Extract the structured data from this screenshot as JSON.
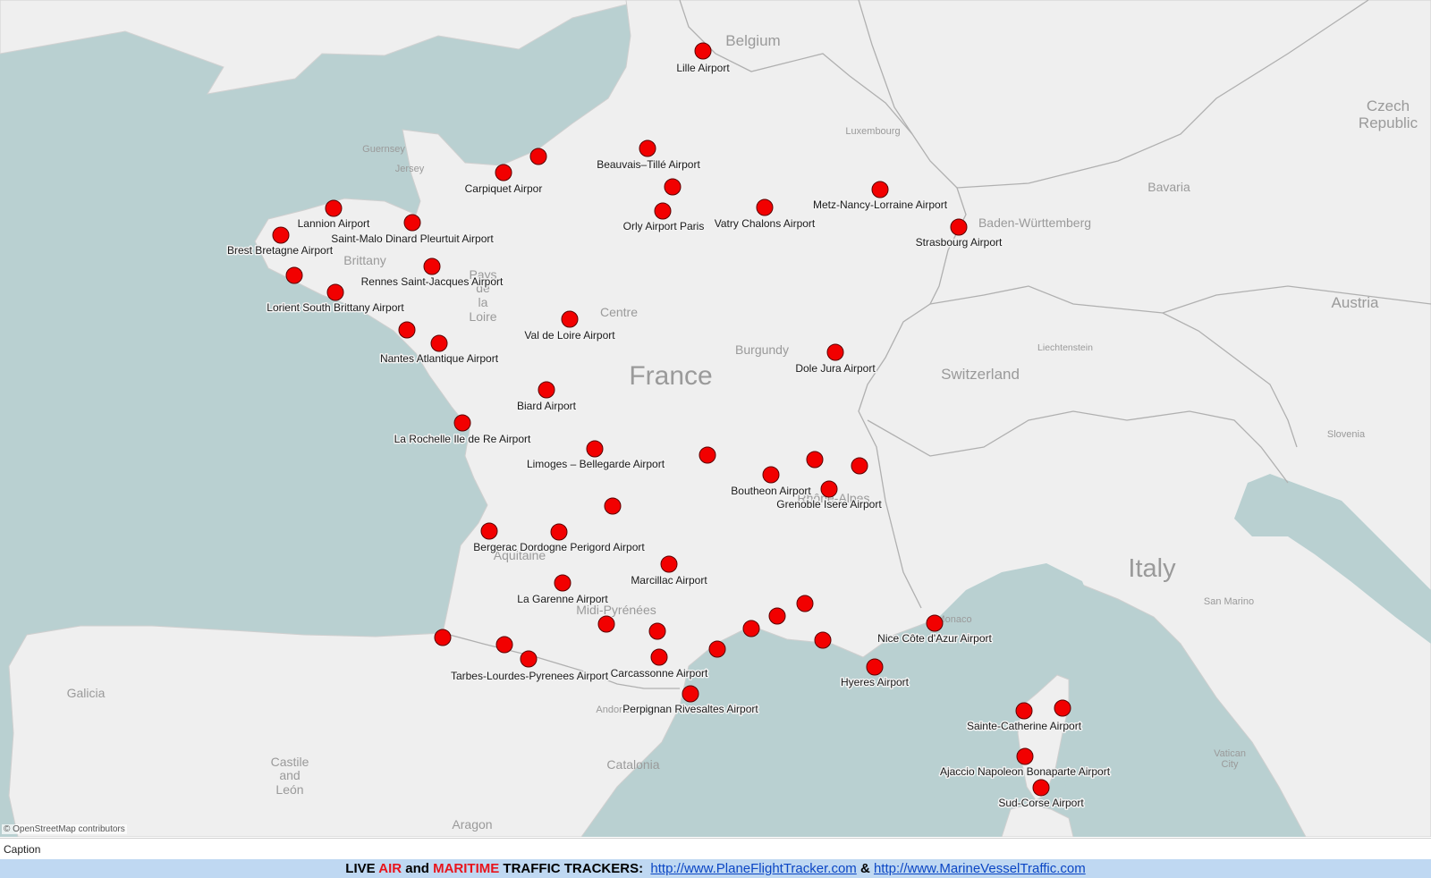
{
  "map": {
    "colors": {
      "water": "#b9d0d1",
      "land": "#efefef",
      "border": "#b5b5b5",
      "marker": "#f20000",
      "marker_stroke": "#5a0000"
    },
    "attribution": "© OpenStreetMap contributors",
    "labels": {
      "belgium": "Belgium",
      "france": "France",
      "czech": "Czech Republic",
      "bavaria": "Bavaria",
      "baden": "Baden-Württemberg",
      "luxembourg": "Luxembourg",
      "austria": "Austria",
      "liechtenstein": "Liechtenstein",
      "switzerland": "Switzerland",
      "slovenia": "Slovenia",
      "italy": "Italy",
      "san_marino": "San Marino",
      "vatican": "Vatican City",
      "monaco": "Monaco",
      "guernsey": "Guernsey",
      "jersey": "Jersey",
      "brittany": "Brittany",
      "pays_de_la_loire": "Pays de la Loire",
      "centre": "Centre",
      "burgundy": "Burgundy",
      "rhone_alpes": "Rhône-Alpes",
      "aquitaine": "Aquitaine",
      "midi_pyrenees": "Midi-Pyrénées",
      "galicia": "Galicia",
      "castile": "Castile and León",
      "catalonia": "Catalonia",
      "aragon": "Aragon",
      "andorra": "Andorra"
    },
    "airports": {
      "lille": "Lille Airport",
      "beauvais": "Beauvais–Tillé Airport",
      "carpiquet": "Carpiquet Airpor",
      "metz": "Metz-Nancy-Lorraine Airport",
      "orly": "Orly Airport Paris",
      "vatry": "Vatry Chalons Airport",
      "strasbourg": "Strasbourg Airport",
      "lannion": "Lannion Airport",
      "saint_malo": "Saint-Malo Dinard Pleurtuit Airport",
      "brest": "Brest Bretagne Airport",
      "rennes": "Rennes Saint-Jacques Airport",
      "lorient": "Lorient South Brittany Airport",
      "nantes": "Nantes Atlantique Airport",
      "val_de_loire": "Val de Loire Airport",
      "dole": "Dole Jura Airport",
      "biard": "Biard Airport",
      "la_rochelle": "La Rochelle Ile de Re Airport",
      "limoges": "Limoges – Bellegarde Airport",
      "boutheon": "Boutheon Airport",
      "grenoble": "Grenoble Isere Airport",
      "bergerac": "Bergerac Dordogne Perigord Airport",
      "marcillac": "Marcillac Airport",
      "la_garenne": "La Garenne Airport",
      "nice": "Nice Côte d'Azur Airport",
      "tarbes": "Tarbes-Lourdes-Pyrenees Airport",
      "carcassonne": "Carcassonne Airport",
      "hyeres": "Hyeres Airport",
      "perpignan": "Perpignan Rivesaltes Airport",
      "sainte_catherine": "Sainte-Catherine Airport",
      "ajaccio": "Ajaccio Napoleon Bonaparte Airport",
      "sud_corse": "Sud-Corse Airport"
    }
  },
  "caption": {
    "label": "Caption"
  },
  "footer": {
    "w1": "LIVE ",
    "w2": "AIR",
    "w3": " and ",
    "w4": "MARITIME",
    "w5": " TRAFFIC TRACKERS:  ",
    "link1": "http://www.PlaneFlightTracker.com",
    "amp": " & ",
    "link2": "http://www.MarineVesselTraffic.com"
  }
}
